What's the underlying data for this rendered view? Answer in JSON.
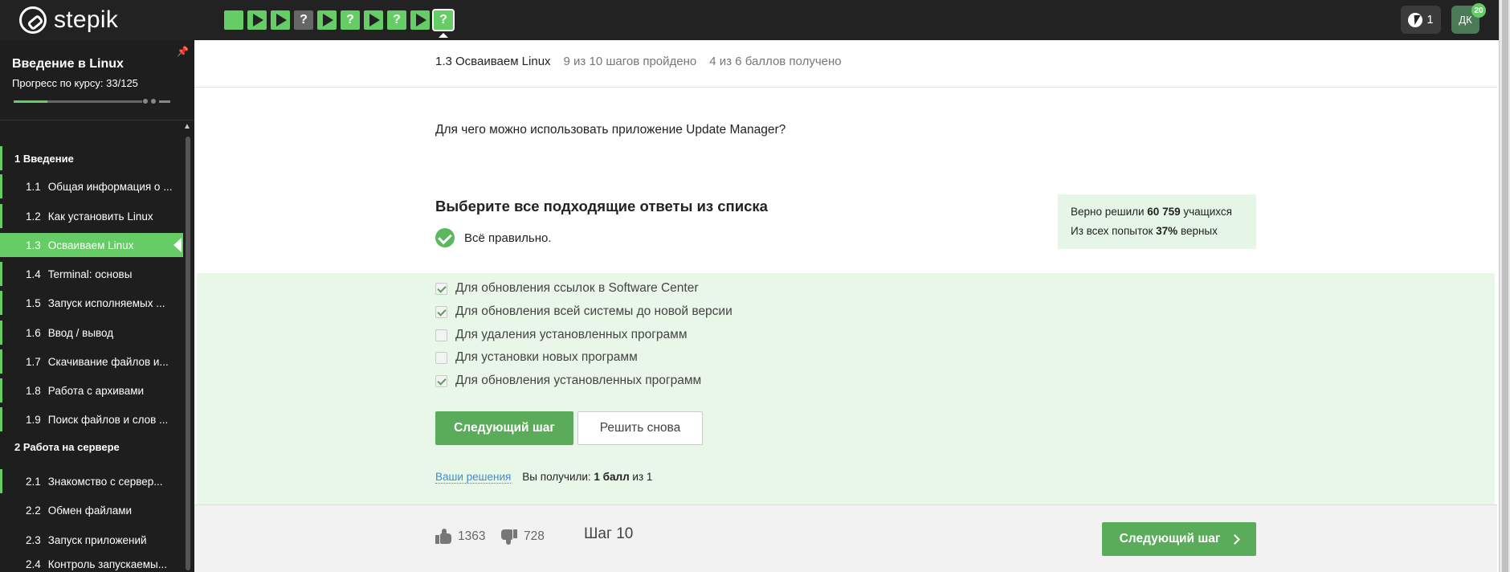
{
  "app": {
    "name": "stepik"
  },
  "steps": [
    {
      "state": "green",
      "icon": "blank"
    },
    {
      "state": "green",
      "icon": "play"
    },
    {
      "state": "green",
      "icon": "play"
    },
    {
      "state": "gray",
      "icon": "?"
    },
    {
      "state": "green",
      "icon": "play"
    },
    {
      "state": "green",
      "icon": "?"
    },
    {
      "state": "green",
      "icon": "play"
    },
    {
      "state": "green",
      "icon": "?"
    },
    {
      "state": "green",
      "icon": "play"
    },
    {
      "state": "green-current",
      "icon": "?"
    }
  ],
  "header": {
    "energy": "1",
    "avatar_initials": "ДК",
    "avatar_badge": "20"
  },
  "sidebar": {
    "course_title": "Введение в Linux",
    "progress_label": "Прогресс по курсу:  33/125",
    "progress_fraction": 0.264,
    "sections": [
      {
        "title": "1  Введение"
      },
      {
        "title": "2  Работа на сервере"
      }
    ],
    "lessons_s1": [
      {
        "num": "1.1",
        "label": "Общая информация о ..."
      },
      {
        "num": "1.2",
        "label": "Как установить Linux"
      },
      {
        "num": "1.3",
        "label": "Осваиваем Linux"
      },
      {
        "num": "1.4",
        "label": "Terminal: основы"
      },
      {
        "num": "1.5",
        "label": "Запуск исполняемых ..."
      },
      {
        "num": "1.6",
        "label": "Ввод / вывод"
      },
      {
        "num": "1.7",
        "label": "Скачивание файлов и..."
      },
      {
        "num": "1.8",
        "label": "Работа с архивами"
      },
      {
        "num": "1.9",
        "label": "Поиск файлов и слов ..."
      }
    ],
    "lessons_s2": [
      {
        "num": "2.1",
        "label": "Знакомство с сервер..."
      },
      {
        "num": "2.2",
        "label": "Обмен файлами"
      },
      {
        "num": "2.3",
        "label": "Запуск приложений"
      },
      {
        "num": "2.4",
        "label": "Контроль запускаемы..."
      }
    ]
  },
  "breadcrumb": {
    "lesson": "1.3 Осваиваем Linux",
    "steps_done": "9 из 10 шагов пройдено",
    "points": "4 из 6 баллов  получено"
  },
  "question": "Для чего можно использовать приложение Update Manager?",
  "task_title": "Выберите все подходящие ответы из списка",
  "status": "Всё правильно.",
  "stats": {
    "line1_prefix": "Верно решили ",
    "line1_count": "60 759",
    "line1_suffix": " учащихся",
    "line2_prefix": "Из всех попыток ",
    "line2_pct": "37%",
    "line2_suffix": " верных"
  },
  "options": [
    {
      "label": "Для обновления ссылок в Software Center",
      "checked": true
    },
    {
      "label": "Для обновления всей системы до новой версии",
      "checked": true
    },
    {
      "label": "Для удаления установленных программ",
      "checked": false
    },
    {
      "label": "Для установки новых программ",
      "checked": false
    },
    {
      "label": "Для обновления установленных программ",
      "checked": true
    }
  ],
  "buttons": {
    "next": "Следующий шаг",
    "retry": "Решить снова"
  },
  "solutions": {
    "link": "Ваши решения",
    "score_prefix": "Вы получили: ",
    "score_value": "1 балл",
    "score_suffix": " из 1"
  },
  "footer": {
    "likes": "1363",
    "dislikes": "728",
    "step": "Шаг 10",
    "next": "Следующий шаг"
  }
}
